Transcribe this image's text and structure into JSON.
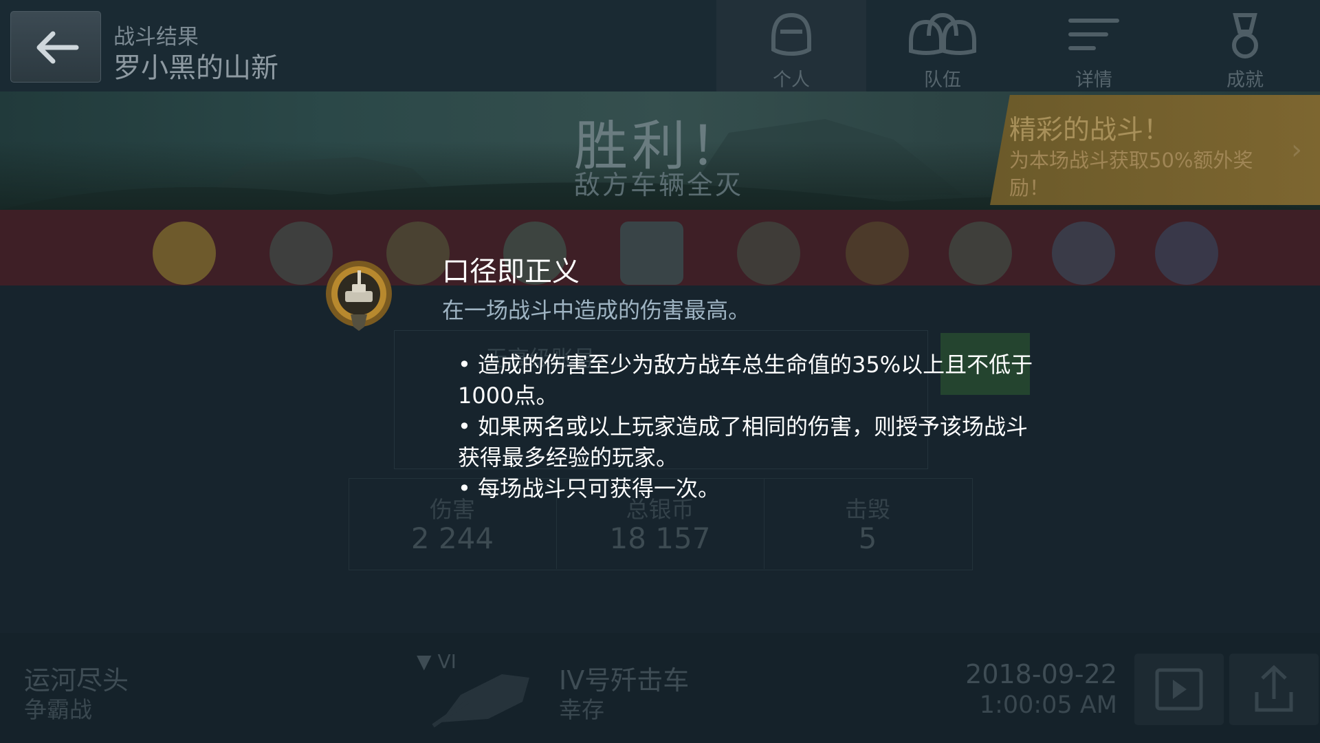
{
  "header": {
    "breadcrumb": "战斗结果",
    "player_name": "罗小黑的山新",
    "tabs": [
      {
        "label": "个人",
        "icon": "person-helmet-icon"
      },
      {
        "label": "队伍",
        "icon": "team-helmets-icon"
      },
      {
        "label": "详情",
        "icon": "details-lines-icon"
      },
      {
        "label": "成就",
        "icon": "achievement-medal-icon"
      }
    ],
    "active_tab": "个人"
  },
  "banner": {
    "title": "胜利！",
    "subtitle": "敌方车辆全灭",
    "promo_title": "精彩的战斗！",
    "promo_desc": "为本场战斗获取50%额外奖励！"
  },
  "stats_bg": {
    "account_label": "无高级账号",
    "stats": [
      {
        "label": "伤害",
        "value": "2 244"
      },
      {
        "label": "总银币",
        "value": "18 157"
      },
      {
        "label": "击毁",
        "value": "5"
      }
    ]
  },
  "popup": {
    "medal_icon": "caliber-medal-icon",
    "title": "口径即正义",
    "description": "在一场战斗中造成的伤害最高。",
    "rules": [
      "• 造成的伤害至少为敌方战车总生命值的35%以上且不低于1000点。",
      "• 如果两名或以上玩家造成了相同的伤害，则授予该场战斗获得最多经验的玩家。",
      "• 每场战斗只可获得一次。"
    ]
  },
  "footer": {
    "map": "运河尽头",
    "mode": "争霸战",
    "tier": "VI",
    "vehicle": "IV号歼击车",
    "survival": "幸存",
    "date": "2018-09-22",
    "time": "1:00:05 AM"
  },
  "colors": {
    "background": "#17242d",
    "strip": "#3e1f26",
    "promo": "#7d6630",
    "accent_text": "#9fb4c3"
  }
}
